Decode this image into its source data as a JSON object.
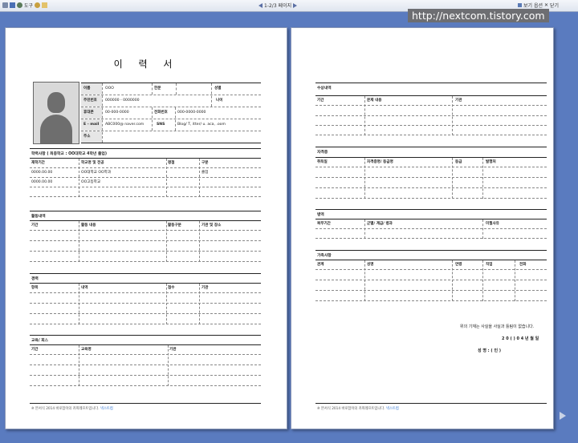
{
  "toolbar": {
    "tool_label": "도구",
    "page_indicator": "1-2/3 페이지",
    "view_options": "보기 옵션",
    "close_label": "닫기"
  },
  "watermark": "http://nextcom.tistory.com",
  "page1": {
    "title": "이 력 서",
    "personal": {
      "name_label": "이름",
      "name_value": "OOO",
      "hanja_label": "한문",
      "gender_label": "성별",
      "rrn_label": "주민번호",
      "rrn_value": "000000 - 0000000",
      "age_label": "나이",
      "phone_label": "휴대폰",
      "phone_value": "00-000-0000",
      "tel_label": "전화번호",
      "tel_value": "000-0000-0000",
      "email_label": "E - mail",
      "email_value": "ABC000@ naver.com",
      "sns_label": "SNS",
      "sns_value": "Blog/ T, itter/ u. aca, .oom",
      "address_label": "주소"
    },
    "education": {
      "title": "학력사항 ( 최종학교 : OO대학교 4학년 졸업)",
      "headers": [
        "재학기간",
        "학교명 및 전공",
        "평점",
        "구분"
      ],
      "rows": [
        [
          "0000.00.00",
          "OO대학교 OO학과",
          "",
          "졸업"
        ],
        [
          "0000.00.00",
          "OO고등학교",
          "",
          ""
        ]
      ]
    },
    "activities": {
      "title": "활동내역",
      "headers": [
        "기간",
        "활동 내용",
        "활동구분",
        "기관 및 장소"
      ]
    },
    "career": {
      "title": "경력",
      "headers": [
        "항목",
        "내역",
        "점수",
        "기관"
      ]
    },
    "awards": {
      "title": "교육/ 회스",
      "headers": [
        "기간",
        "교육명",
        "기관"
      ]
    },
    "footer_text": "※ 본서식 2014 바로잡이의 카피레프트입니다.",
    "footer_link": "넥스트컴"
  },
  "page2": {
    "sec1": {
      "title": "수상내역",
      "headers": [
        "기간",
        "문제 내용",
        "기관"
      ]
    },
    "sec2": {
      "title": "자격증",
      "headers": [
        "취득일",
        "자격증명/ 등급명",
        "등급",
        "발행처"
      ]
    },
    "sec3": {
      "title": "병역",
      "headers": [
        "복무기간",
        "군별/ 계급/ 병과",
        "미필사유"
      ]
    },
    "sec4": {
      "title": "가족사항",
      "headers": [
        "관계",
        "성명",
        "연령",
        "직업",
        "전화"
      ]
    },
    "statement": "위의 기재는 사실을 사실과 틀림이 없습니다.",
    "date": "2 0 ( ) 0 4 년    월    일",
    "signer": "성 명 :             ( 인 )",
    "footer_text": "※ 본서식 2014 바로잡이의 카피레프트입니다.",
    "footer_link": "넥스트컴"
  }
}
